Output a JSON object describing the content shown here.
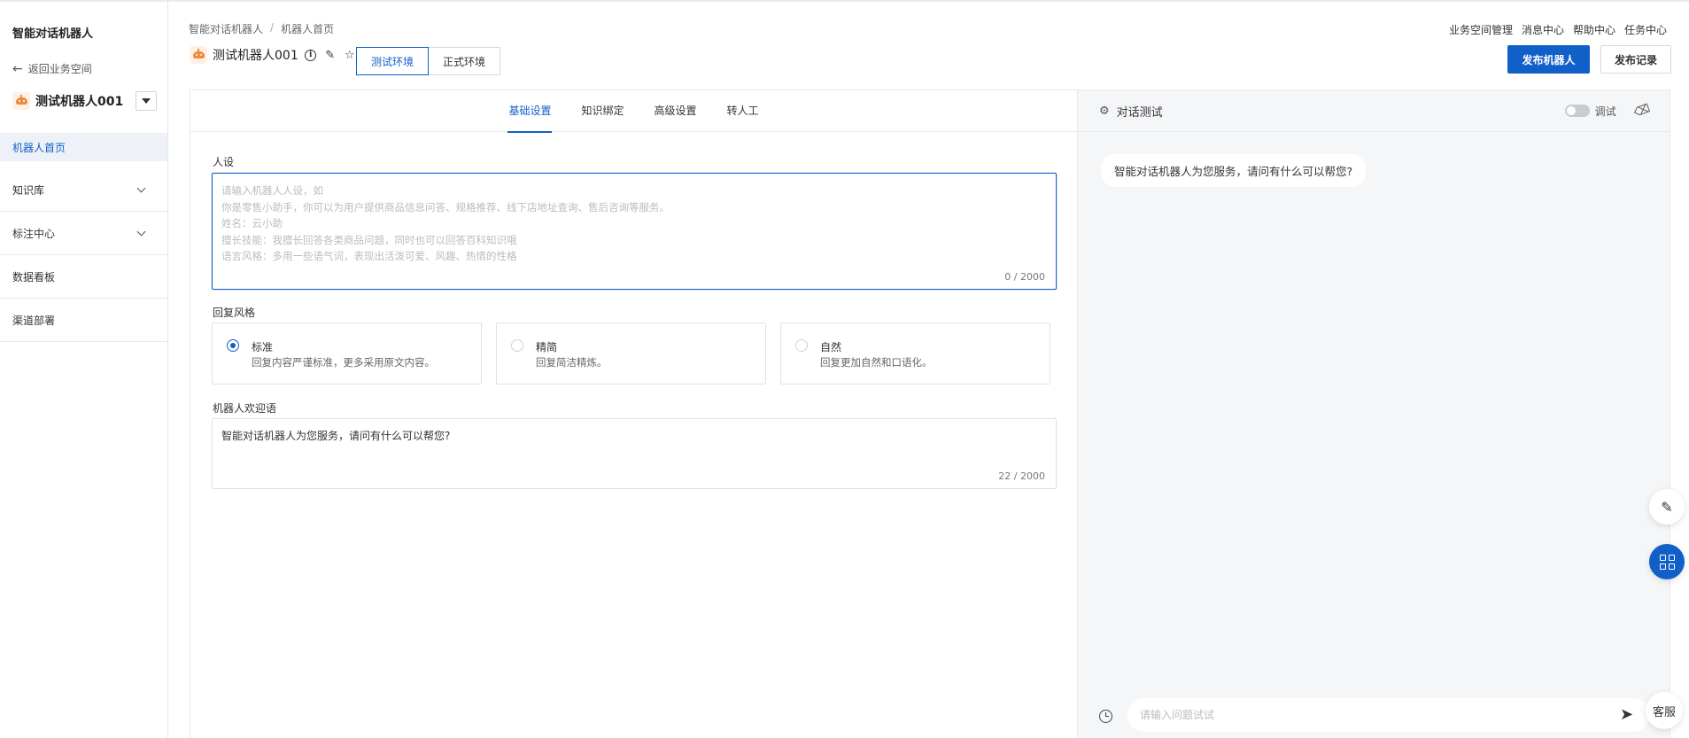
{
  "app": {
    "title": "智能对话机器人"
  },
  "sidebar": {
    "back_label": "返回业务空间",
    "bot_name": "测试机器人001",
    "items": [
      {
        "label": "机器人首页",
        "active": true,
        "expandable": false
      },
      {
        "label": "知识库",
        "active": false,
        "expandable": true
      },
      {
        "label": "标注中心",
        "active": false,
        "expandable": true
      },
      {
        "label": "数据看板",
        "active": false,
        "expandable": false
      },
      {
        "label": "渠道部署",
        "active": false,
        "expandable": false
      }
    ]
  },
  "header": {
    "breadcrumb": [
      "智能对话机器人",
      "机器人首页"
    ],
    "links": [
      "业务空间管理",
      "消息中心",
      "帮助中心",
      "任务中心"
    ],
    "bot_title": "测试机器人001",
    "env_tabs": [
      "测试环境",
      "正式环境"
    ],
    "active_env": "测试环境",
    "publish_label": "发布机器人",
    "history_label": "发布记录"
  },
  "config": {
    "tabs": [
      "基础设置",
      "知识绑定",
      "高级设置",
      "转人工"
    ],
    "active_tab": "基础设置",
    "persona": {
      "label": "人设",
      "placeholder": "请输入机器人人设，如\n你是零售小助手，你可以为用户提供商品信息问答、规格推荐、线下店地址查询、售后咨询等服务。\n姓名：云小助\n擅长技能：我擅长回答各类商品问题，同时也可以回答百科知识哦\n语言风格：多用一些语气词，表现出活泼可爱、风趣、热情的性格",
      "counter": "0 / 2000"
    },
    "reply_style": {
      "label": "回复风格",
      "options": [
        {
          "name": "标准",
          "desc": "回复内容严谨标准，更多采用原文内容。",
          "selected": true
        },
        {
          "name": "精简",
          "desc": "回复简洁精炼。",
          "selected": false
        },
        {
          "name": "自然",
          "desc": "回复更加自然和口语化。",
          "selected": false
        }
      ]
    },
    "welcome": {
      "label": "机器人欢迎语",
      "value": "智能对话机器人为您服务，请问有什么可以帮您?",
      "counter": "22 / 2000"
    }
  },
  "chat_test": {
    "title": "对话测试",
    "debug_label": "调试",
    "debug_on": false,
    "bot_message": "智能对话机器人为您服务，请问有什么可以帮您?",
    "input_placeholder": "请输入问题试试"
  },
  "floating": {
    "service_label": "客服"
  },
  "colors": {
    "primary": "#1160c9",
    "avatar_orange": "#f08a3c"
  },
  "icons": [
    "back-arrow-icon",
    "bot-avatar-icon",
    "chevron-down-icon",
    "info-icon",
    "edit-icon",
    "star-icon",
    "gear-icon",
    "clear-icon",
    "clock-icon",
    "send-icon",
    "grid-icon"
  ]
}
